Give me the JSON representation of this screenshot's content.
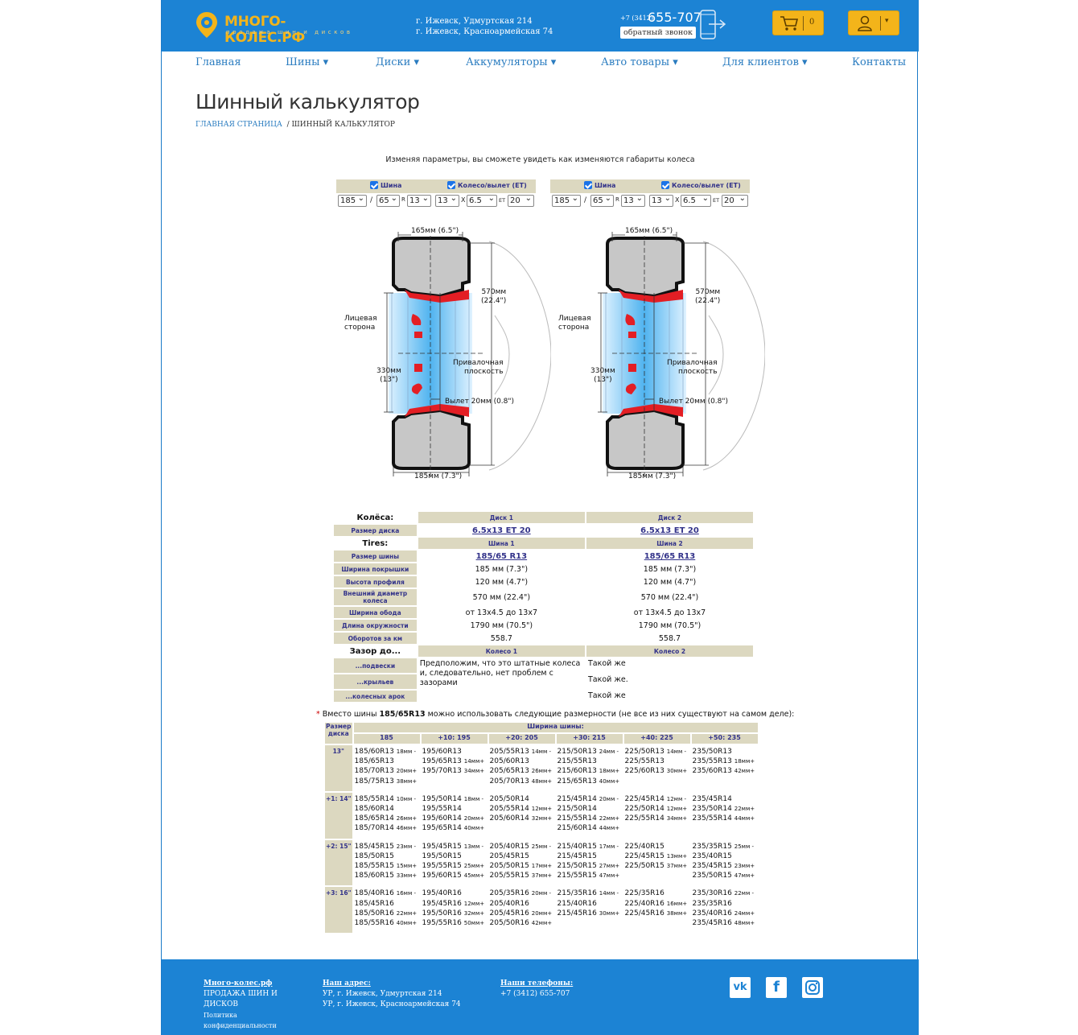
{
  "header": {
    "logo_title": "МНОГО-КОЛЕС.РФ",
    "logo_sub": "продажа шин и дисков",
    "address_1": "г. Ижевск, Удмуртская 214",
    "address_2": "г. Ижевск, Красноармейская 74",
    "phone_code": "+7 (3412)",
    "phone_number": "655-707",
    "callback": "обратный звонок",
    "cart_count": "0",
    "accent": "#f3b41a",
    "brand": "#1c83d4"
  },
  "nav": [
    "Главная",
    "Шины",
    "Диски",
    "Аккумуляторы",
    "Авто товары",
    "Для клиентов",
    "Контакты"
  ],
  "page": {
    "title": "Шинный калькулятор",
    "crumb_home": "ГЛАВНАЯ СТРАНИЦА",
    "crumb_sep": "/",
    "crumb_current": "ШИННЫЙ КАЛЬКУЛЯТОР",
    "intro": "Изменяя параметры, вы сможете увидеть как изменяются габариты колеса"
  },
  "calculators": [
    {
      "tire_label": "Шина",
      "wheel_label": "Колесо/вылет (ET)",
      "width": "185",
      "slash": "/",
      "profile": "65",
      "r": "R",
      "diameter": "13",
      "rim_d": "13",
      "x": "X",
      "rim_w": "6.5",
      "et_label": "ET",
      "et": "20"
    },
    {
      "tire_label": "Шина",
      "wheel_label": "Колесо/вылет (ET)",
      "width": "185",
      "slash": "/",
      "profile": "65",
      "r": "R",
      "diameter": "13",
      "rim_d": "13",
      "x": "X",
      "rim_w": "6.5",
      "et_label": "ET",
      "et": "20"
    }
  ],
  "diagram": {
    "top_width": "165мм (6.5\")",
    "outer_d_1": "570мм",
    "outer_d_2": "(22.4\")",
    "face_1": "Лицевая",
    "face_2": "сторона",
    "mount_1": "Привалочная",
    "mount_2": "плоскость",
    "rim_d_1": "330мм",
    "rim_d_2": "(13\")",
    "offset": "Вылет 20мм (0.8\")",
    "bottom_width": "185мм (7.3\")"
  },
  "spec": {
    "wheels_label": "Колёса:",
    "disk1": "Диск 1",
    "disk2": "Диск 2",
    "disk_size_label": "Размер диска",
    "disk_size_1": "6.5x13 ET 20",
    "disk_size_2": "6.5x13 ET 20",
    "tires_label": "Tires:",
    "tire1": "Шина 1",
    "tire2": "Шина 2",
    "rows": [
      {
        "label": "Размер шины",
        "v1": "185/65 R13",
        "v2": "185/65 R13",
        "link": true
      },
      {
        "label": "Ширина покрышки",
        "v1": "185 мм (7.3\")",
        "v2": "185 мм (7.3\")"
      },
      {
        "label": "Высота профиля",
        "v1": "120 мм (4.7\")",
        "v2": "120 мм (4.7\")"
      },
      {
        "label": "Внешний диаметр колеса",
        "v1": "570 мм (22.4\")",
        "v2": "570 мм (22.4\")"
      },
      {
        "label": "Ширина обода",
        "v1": "от 13x4.5 до 13x7",
        "v2": "от 13x4.5 до 13x7"
      },
      {
        "label": "Длина окружности",
        "v1": "1790 мм (70.5\")",
        "v2": "1790 мм (70.5\")"
      },
      {
        "label": "Оборотов за км",
        "v1": "558.7",
        "v2": "558.7"
      }
    ],
    "gap_label": "Зазор до...",
    "wheel1": "Колесо 1",
    "wheel2": "Колесо 2",
    "gap_rows": [
      {
        "label": "...подвески",
        "v2": "Такой же"
      },
      {
        "label": "...крыльев",
        "v2": "Такой же."
      },
      {
        "label": "...колесных арок",
        "v2": "Такой же"
      }
    ],
    "gap_note": "Предположим, что это штатные колеса и, следовательно, нет проблем с зазорами"
  },
  "note": {
    "star": "*",
    "prefix": "Вместо шины",
    "size": "185/65R13",
    "suffix": "можно использовать следующие размерности (не все из них существуют на самом деле):"
  },
  "sizes": {
    "size_label": "Размер диска",
    "width_label": "Ширина шины:",
    "columns": [
      "185",
      "+10: 195",
      "+20: 205",
      "+30: 215",
      "+40: 225",
      "+50: 235"
    ],
    "rows": [
      {
        "rim": "13\"",
        "cells": [
          [
            [
              "185/60R13",
              "18мм -"
            ],
            [
              "185/65R13",
              ""
            ],
            [
              "185/70R13",
              "20мм+"
            ],
            [
              "185/75R13",
              "38мм+"
            ]
          ],
          [
            [
              "195/60R13",
              ""
            ],
            [
              "195/65R13",
              "14мм+"
            ],
            [
              "195/70R13",
              "34мм+"
            ]
          ],
          [
            [
              "205/55R13",
              "14мм -"
            ],
            [
              "205/60R13",
              ""
            ],
            [
              "205/65R13",
              "26мм+"
            ],
            [
              "205/70R13",
              "48мм+"
            ]
          ],
          [
            [
              "215/50R13",
              "24мм -"
            ],
            [
              "215/55R13",
              ""
            ],
            [
              "215/60R13",
              "18мм+"
            ],
            [
              "215/65R13",
              "40мм+"
            ]
          ],
          [
            [
              "225/50R13",
              "14мм -"
            ],
            [
              "225/55R13",
              ""
            ],
            [
              "225/60R13",
              "30мм+"
            ]
          ],
          [
            [
              "235/50R13",
              ""
            ],
            [
              "235/55R13",
              "18мм+"
            ],
            [
              "235/60R13",
              "42мм+"
            ]
          ]
        ]
      },
      {
        "rim": "+1: 14\"",
        "cells": [
          [
            [
              "185/55R14",
              "10мм -"
            ],
            [
              "185/60R14",
              ""
            ],
            [
              "185/65R14",
              "26мм+"
            ],
            [
              "185/70R14",
              "46мм+"
            ]
          ],
          [
            [
              "195/50R14",
              "18мм -"
            ],
            [
              "195/55R14",
              ""
            ],
            [
              "195/60R14",
              "20мм+"
            ],
            [
              "195/65R14",
              "40мм+"
            ]
          ],
          [
            [
              "205/50R14",
              ""
            ],
            [
              "205/55R14",
              "12мм+"
            ],
            [
              "205/60R14",
              "32мм+"
            ]
          ],
          [
            [
              "215/45R14",
              "20мм -"
            ],
            [
              "215/50R14",
              ""
            ],
            [
              "215/55R14",
              "22мм+"
            ],
            [
              "215/60R14",
              "44мм+"
            ]
          ],
          [
            [
              "225/45R14",
              "12мм -"
            ],
            [
              "225/50R14",
              "12мм+"
            ],
            [
              "225/55R14",
              "34мм+"
            ]
          ],
          [
            [
              "235/45R14",
              ""
            ],
            [
              "235/50R14",
              "22мм+"
            ],
            [
              "235/55R14",
              "44мм+"
            ]
          ]
        ]
      },
      {
        "rim": "+2: 15\"",
        "cells": [
          [
            [
              "185/45R15",
              "23мм -"
            ],
            [
              "185/50R15",
              ""
            ],
            [
              "185/55R15",
              "15мм+"
            ],
            [
              "185/60R15",
              "33мм+"
            ]
          ],
          [
            [
              "195/45R15",
              "13мм -"
            ],
            [
              "195/50R15",
              ""
            ],
            [
              "195/55R15",
              "25мм+"
            ],
            [
              "195/60R15",
              "45мм+"
            ]
          ],
          [
            [
              "205/40R15",
              "25мм -"
            ],
            [
              "205/45R15",
              ""
            ],
            [
              "205/50R15",
              "17мм+"
            ],
            [
              "205/55R15",
              "37мм+"
            ]
          ],
          [
            [
              "215/40R15",
              "17мм -"
            ],
            [
              "215/45R15",
              ""
            ],
            [
              "215/50R15",
              "27мм+"
            ],
            [
              "215/55R15",
              "47мм+"
            ]
          ],
          [
            [
              "225/40R15",
              ""
            ],
            [
              "225/45R15",
              "13мм+"
            ],
            [
              "225/50R15",
              "37мм+"
            ]
          ],
          [
            [
              "235/35R15",
              "25мм -"
            ],
            [
              "235/40R15",
              ""
            ],
            [
              "235/45R15",
              "23мм+"
            ],
            [
              "235/50R15",
              "47мм+"
            ]
          ]
        ]
      },
      {
        "rim": "+3: 16\"",
        "cells": [
          [
            [
              "185/40R16",
              "16мм -"
            ],
            [
              "185/45R16",
              ""
            ],
            [
              "185/50R16",
              "22мм+"
            ],
            [
              "185/55R16",
              "40мм+"
            ]
          ],
          [
            [
              "195/40R16",
              ""
            ],
            [
              "195/45R16",
              "12мм+"
            ],
            [
              "195/50R16",
              "32мм+"
            ],
            [
              "195/55R16",
              "50мм+"
            ]
          ],
          [
            [
              "205/35R16",
              "20мм -"
            ],
            [
              "205/40R16",
              ""
            ],
            [
              "205/45R16",
              "20мм+"
            ],
            [
              "205/50R16",
              "42мм+"
            ]
          ],
          [
            [
              "215/35R16",
              "14мм -"
            ],
            [
              "215/40R16",
              ""
            ],
            [
              "215/45R16",
              "30мм+"
            ]
          ],
          [
            [
              "225/35R16",
              ""
            ],
            [
              "225/40R16",
              "16мм+"
            ],
            [
              "225/45R16",
              "38мм+"
            ]
          ],
          [
            [
              "235/30R16",
              "22мм -"
            ],
            [
              "235/35R16",
              ""
            ],
            [
              "235/40R16",
              "24мм+"
            ],
            [
              "235/45R16",
              "48мм+"
            ]
          ]
        ]
      }
    ]
  },
  "footer": {
    "site": "Много-колес.рф",
    "site_sub": "ПРОДАЖА ШИН И ДИСКОВ",
    "privacy": "Политика конфиденциальности",
    "address_h": "Наш адрес:",
    "address_1": "УР, г. Ижевск, Удмуртская 214",
    "address_2": "УР, г. Ижевск, Красноармейская 74",
    "phones_h": "Наши телефоны:",
    "phone": "+7 (3412) 655-707",
    "social": [
      "vk-icon",
      "facebook-icon",
      "instagram-icon"
    ]
  }
}
